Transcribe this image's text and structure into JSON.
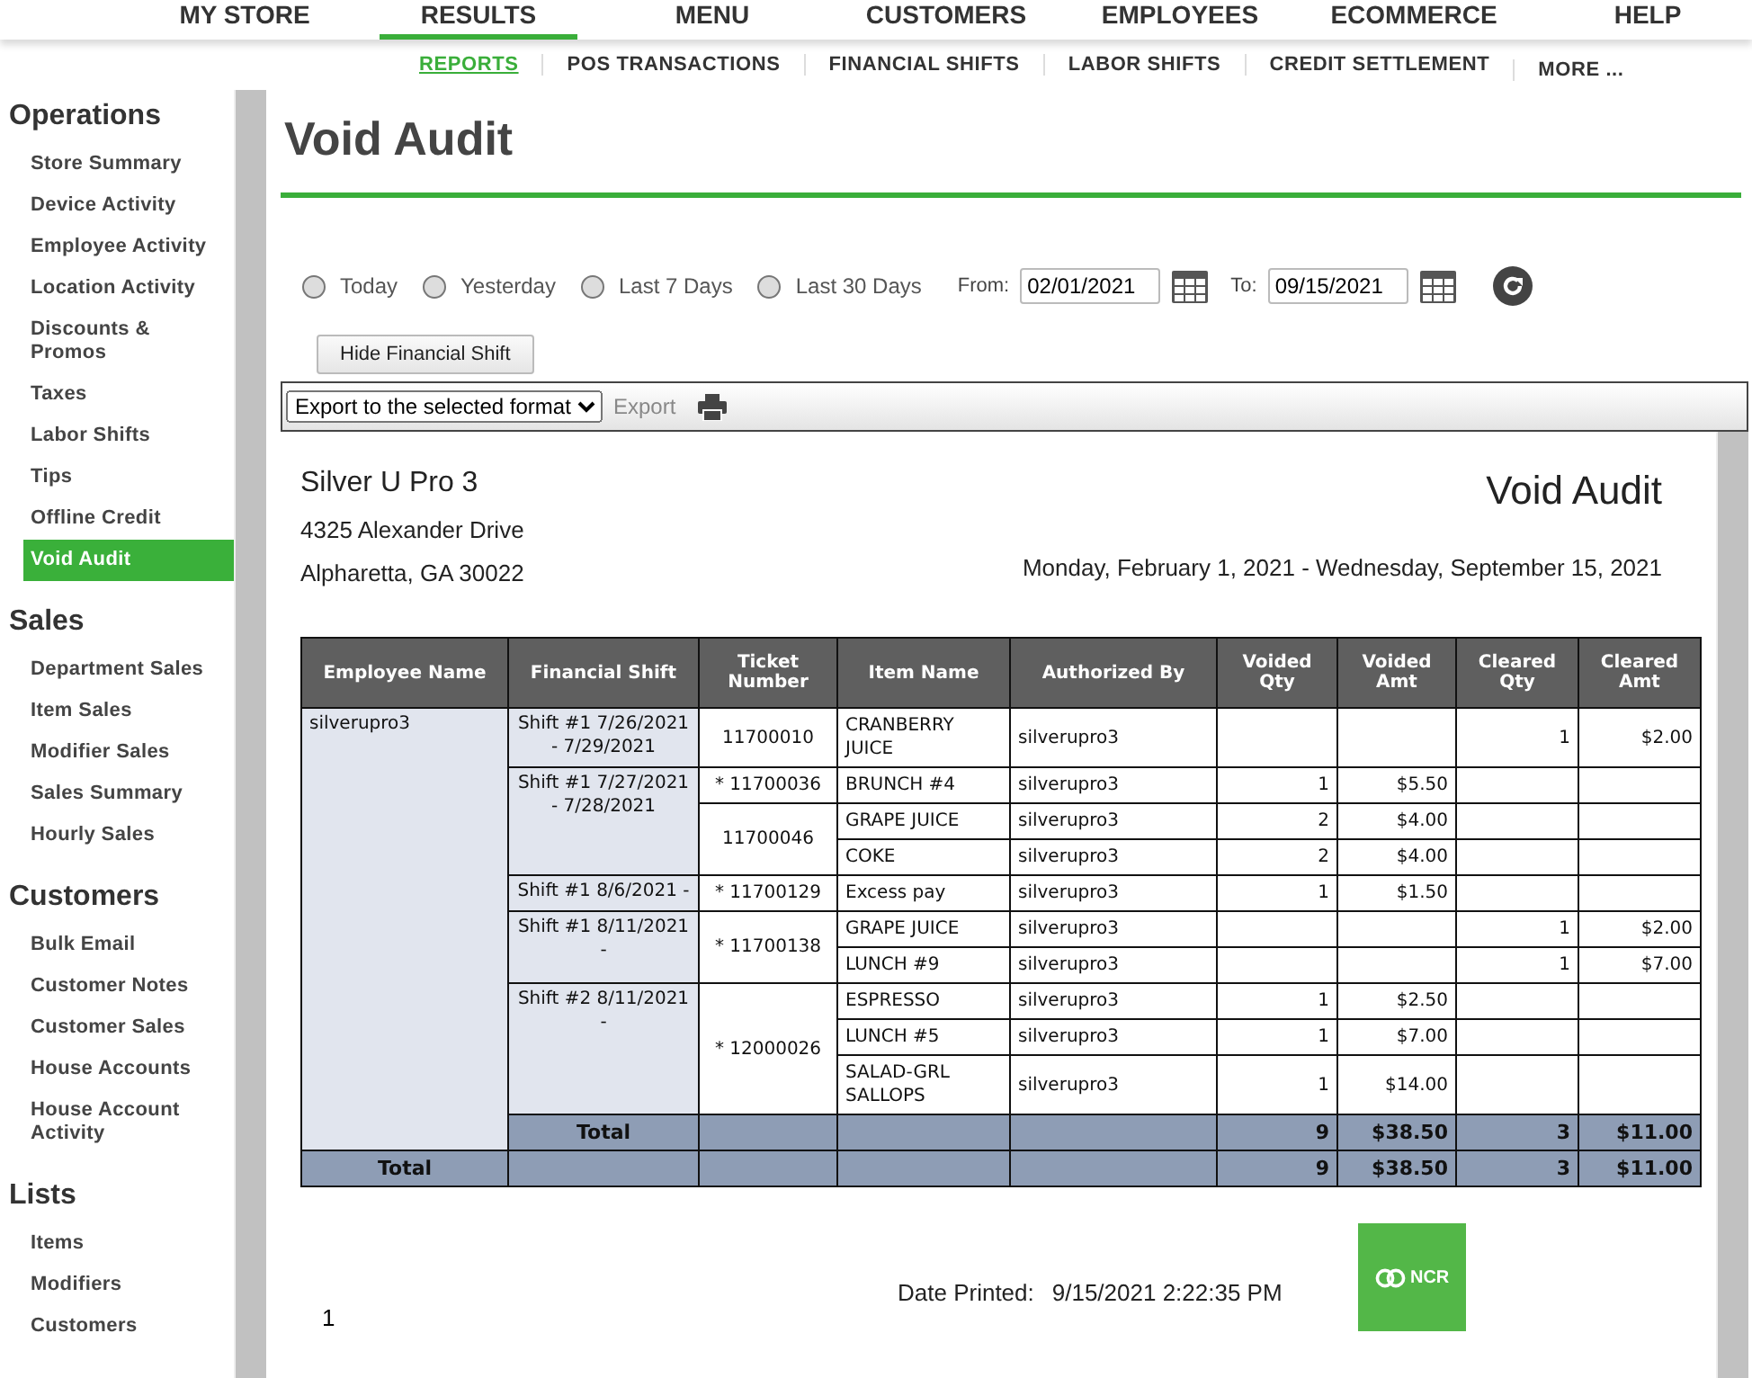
{
  "top_nav": [
    {
      "label": "MY STORE",
      "selected": false
    },
    {
      "label": "RESULTS",
      "selected": true
    },
    {
      "label": "MENU",
      "selected": false
    },
    {
      "label": "CUSTOMERS",
      "selected": false
    },
    {
      "label": "EMPLOYEES",
      "selected": false
    },
    {
      "label": "ECOMMERCE",
      "selected": false
    },
    {
      "label": "HELP",
      "selected": false
    }
  ],
  "sub_nav": [
    {
      "label": "REPORTS",
      "selected": true
    },
    {
      "label": "POS TRANSACTIONS",
      "selected": false
    },
    {
      "label": "FINANCIAL SHIFTS",
      "selected": false
    },
    {
      "label": "LABOR SHIFTS",
      "selected": false
    },
    {
      "label": "CREDIT SETTLEMENT",
      "selected": false
    },
    {
      "label": "MORE ...",
      "selected": false
    }
  ],
  "sidebar": {
    "sections": [
      {
        "title": "Operations",
        "items": [
          {
            "label": "Store Summary",
            "selected": false
          },
          {
            "label": "Device Activity",
            "selected": false
          },
          {
            "label": "Employee Activity",
            "selected": false
          },
          {
            "label": "Location Activity",
            "selected": false
          },
          {
            "label": "Discounts & Promos",
            "selected": false
          },
          {
            "label": "Taxes",
            "selected": false
          },
          {
            "label": "Labor Shifts",
            "selected": false
          },
          {
            "label": "Tips",
            "selected": false
          },
          {
            "label": "Offline Credit",
            "selected": false
          },
          {
            "label": "Void Audit",
            "selected": true
          }
        ]
      },
      {
        "title": "Sales",
        "items": [
          {
            "label": "Department Sales",
            "selected": false
          },
          {
            "label": "Item Sales",
            "selected": false
          },
          {
            "label": "Modifier Sales",
            "selected": false
          },
          {
            "label": "Sales Summary",
            "selected": false
          },
          {
            "label": "Hourly Sales",
            "selected": false
          }
        ]
      },
      {
        "title": "Customers",
        "items": [
          {
            "label": "Bulk Email",
            "selected": false
          },
          {
            "label": "Customer Notes",
            "selected": false
          },
          {
            "label": "Customer Sales",
            "selected": false
          },
          {
            "label": "House Accounts",
            "selected": false
          },
          {
            "label": "House Account Activity",
            "selected": false
          }
        ]
      },
      {
        "title": "Lists",
        "items": [
          {
            "label": "Items",
            "selected": false
          },
          {
            "label": "Modifiers",
            "selected": false
          },
          {
            "label": "Customers",
            "selected": false
          }
        ]
      }
    ]
  },
  "page_title": "Void Audit",
  "filters": {
    "ranges": [
      {
        "label": "Today",
        "selected": false
      },
      {
        "label": "Yesterday",
        "selected": false
      },
      {
        "label": "Last 7 Days",
        "selected": false
      },
      {
        "label": "Last 30 Days",
        "selected": false
      }
    ],
    "from_label": "From:",
    "from_value": "02/01/2021",
    "to_label": "To:",
    "to_value": "09/15/2021",
    "hide_button": "Hide Financial Shift"
  },
  "toolbar": {
    "format_select": "Export to the selected format",
    "export_button": "Export"
  },
  "report": {
    "store_name": "Silver U Pro 3",
    "address_1": "4325 Alexander Drive",
    "address_2": "Alpharetta, GA 30022",
    "title": "Void Audit",
    "date_range": "Monday, February 1, 2021 - Wednesday, September 15, 2021",
    "table": {
      "columns": [
        "Employee Name",
        "Financial Shift",
        "Ticket Number",
        "Item Name",
        "Authorized By",
        "Voided Qty",
        "Voided Amt",
        "Cleared Qty",
        "Cleared Amt"
      ],
      "employees": [
        {
          "name": "silverupro3",
          "shifts": [
            {
              "label": "Shift #1 7/26/2021 - 7/29/2021",
              "tickets": [
                {
                  "number": "11700010",
                  "items": [
                    {
                      "name": "CRANBERRY JUICE",
                      "authorized_by": "silverupro3",
                      "cleared_qty": "1",
                      "cleared_amt": "$2.00"
                    }
                  ]
                }
              ]
            },
            {
              "label": "Shift #1 7/27/2021 - 7/28/2021",
              "tickets": [
                {
                  "number": "* 11700036",
                  "items": [
                    {
                      "name": "BRUNCH #4",
                      "authorized_by": "silverupro3",
                      "voided_qty": "1",
                      "voided_amt": "$5.50"
                    }
                  ]
                },
                {
                  "number": "11700046",
                  "items": [
                    {
                      "name": "GRAPE JUICE",
                      "authorized_by": "silverupro3",
                      "voided_qty": "2",
                      "voided_amt": "$4.00"
                    },
                    {
                      "name": "COKE",
                      "authorized_by": "silverupro3",
                      "voided_qty": "2",
                      "voided_amt": "$4.00"
                    }
                  ]
                }
              ]
            },
            {
              "label": "Shift #1 8/6/2021 -",
              "tickets": [
                {
                  "number": "* 11700129",
                  "items": [
                    {
                      "name": "Excess pay",
                      "authorized_by": "silverupro3",
                      "voided_qty": "1",
                      "voided_amt": "$1.50"
                    }
                  ]
                }
              ]
            },
            {
              "label": "Shift #1 8/11/2021 -",
              "tickets": [
                {
                  "number": "* 11700138",
                  "items": [
                    {
                      "name": "GRAPE JUICE",
                      "authorized_by": "silverupro3",
                      "cleared_qty": "1",
                      "cleared_amt": "$2.00"
                    },
                    {
                      "name": "LUNCH #9",
                      "authorized_by": "silverupro3",
                      "cleared_qty": "1",
                      "cleared_amt": "$7.00"
                    }
                  ]
                }
              ]
            },
            {
              "label": "Shift #2 8/11/2021 -",
              "tickets": [
                {
                  "number": "* 12000026",
                  "items": [
                    {
                      "name": "ESPRESSO",
                      "authorized_by": "silverupro3",
                      "voided_qty": "1",
                      "voided_amt": "$2.50"
                    },
                    {
                      "name": "LUNCH #5",
                      "authorized_by": "silverupro3",
                      "voided_qty": "1",
                      "voided_amt": "$7.00"
                    },
                    {
                      "name": "SALAD-GRL SALLOPS",
                      "authorized_by": "silverupro3",
                      "voided_qty": "1",
                      "voided_amt": "$14.00"
                    }
                  ]
                }
              ]
            }
          ],
          "total": {
            "label": "Total",
            "voided_qty": "9",
            "voided_amt": "$38.50",
            "cleared_qty": "3",
            "cleared_amt": "$11.00"
          }
        }
      ],
      "grand_total": {
        "label": "Total",
        "voided_qty": "9",
        "voided_amt": "$38.50",
        "cleared_qty": "3",
        "cleared_amt": "$11.00"
      }
    },
    "page_number": "1",
    "date_printed_label": "Date Printed:",
    "date_printed": "9/15/2021 2:22:35 PM",
    "logo_text": "NCR"
  }
}
